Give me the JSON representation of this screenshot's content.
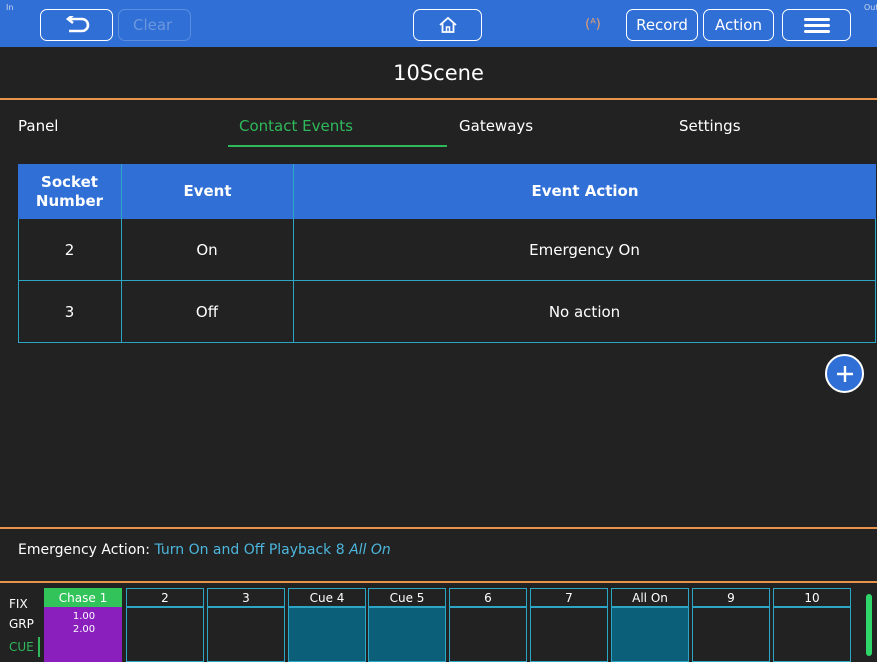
{
  "toolbar": {
    "corner_left": "In",
    "corner_right": "Out",
    "back_icon": "undo-arrow-icon",
    "clear_label": "Clear",
    "home_icon": "home-icon",
    "antenna_icon": "antenna-icon",
    "antenna_glyph": "(ᴬ)",
    "record_label": "Record",
    "action_label": "Action",
    "menu_icon": "hamburger-menu-icon"
  },
  "page": {
    "title": "10Scene"
  },
  "tabs": [
    {
      "label": "Panel",
      "active": false
    },
    {
      "label": "Contact Events",
      "active": true
    },
    {
      "label": "Gateways",
      "active": false
    },
    {
      "label": "Settings",
      "active": false
    }
  ],
  "table": {
    "headers": [
      "Socket Number",
      "Event",
      "Event Action"
    ],
    "header_socket_line1": "Socket",
    "header_socket_line2": "Number",
    "rows": [
      {
        "socket": "2",
        "event": "On",
        "action": "Emergency On"
      },
      {
        "socket": "3",
        "event": "Off",
        "action": "No action"
      }
    ]
  },
  "add_button": {
    "icon": "plus-icon"
  },
  "emergency": {
    "label": "Emergency Action:",
    "value": "Turn On and Off Playback 8",
    "value_em": "All On"
  },
  "strip": {
    "side_labels": [
      "FIX",
      "GRP",
      "CUE"
    ],
    "active_side": "CUE",
    "playbacks": [
      {
        "label": "Chase 1",
        "times": [
          "1.00",
          "2.00"
        ],
        "state": "active"
      },
      {
        "label": "2",
        "state": "empty"
      },
      {
        "label": "3",
        "state": "empty"
      },
      {
        "label": "Cue 4",
        "state": "lit"
      },
      {
        "label": "Cue 5",
        "state": "lit"
      },
      {
        "label": "6",
        "state": "empty"
      },
      {
        "label": "7",
        "state": "empty"
      },
      {
        "label": "All On",
        "state": "lit"
      },
      {
        "label": "9",
        "state": "empty"
      },
      {
        "label": "10",
        "state": "empty"
      }
    ]
  },
  "colors": {
    "accent_blue": "#2f6fd6",
    "accent_orange": "#e8944a",
    "active_green": "#2fb95b",
    "cell_border": "#2da6c6",
    "lit_playback": "#0b5f79",
    "active_playback": "#8a1fbd",
    "emergency_value": "#4cb6dd"
  }
}
